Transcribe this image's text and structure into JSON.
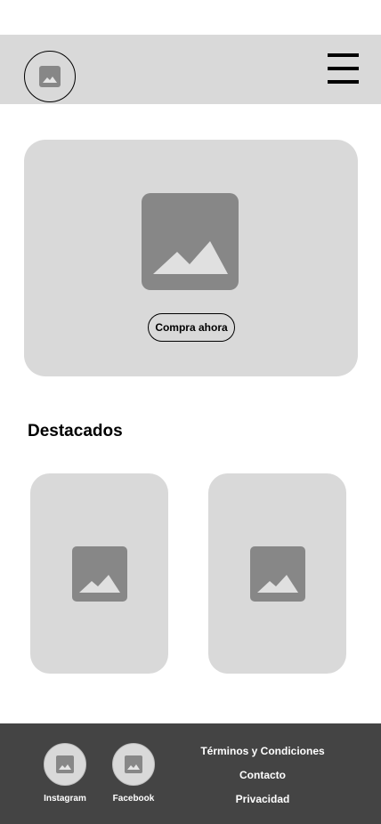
{
  "header": {
    "logo_icon": "image-placeholder-icon",
    "menu_icon": "hamburger-menu-icon"
  },
  "hero": {
    "image_icon": "image-placeholder-icon",
    "cta_label": "Compra ahora"
  },
  "featured": {
    "title": "Destacados",
    "cards": [
      {
        "icon": "image-placeholder-icon"
      },
      {
        "icon": "image-placeholder-icon"
      }
    ]
  },
  "footer": {
    "social": [
      {
        "label": "Instagram",
        "icon": "image-placeholder-icon"
      },
      {
        "label": "Facebook",
        "icon": "image-placeholder-icon"
      }
    ],
    "links": [
      "Términos y Condiciones",
      "Contacto",
      "Privacidad"
    ]
  },
  "colors": {
    "header_bg": "#d9d9d9",
    "placeholder_gray": "#878787",
    "footer_bg": "#444444"
  }
}
